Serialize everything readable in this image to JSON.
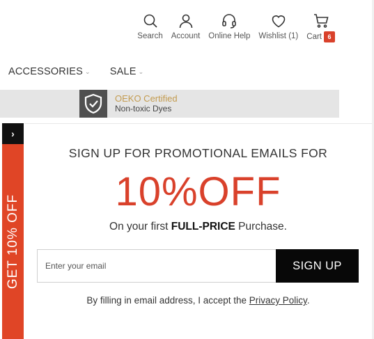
{
  "nav": {
    "search": "Search",
    "account": "Account",
    "help": "Online Help",
    "wishlist": "Wishlist (1)",
    "cart": "Cart",
    "cart_count": "6"
  },
  "categories": [
    {
      "label": "ACCESSORIES",
      "caret": "⌄"
    },
    {
      "label": "SALE",
      "caret": "⌄"
    }
  ],
  "banner": {
    "title": "OEKO Certified",
    "subtitle": "Non-toxic Dyes",
    "icon": "shield-check-icon"
  },
  "side_tab": {
    "arrow": "›",
    "label": "GET 10% OFF"
  },
  "popup": {
    "title": "SIGN UP FOR PROMOTIONAL EMAILS FOR",
    "headline": "10%OFF",
    "sub_prefix": "On your first ",
    "sub_bold": "FULL-PRICE",
    "sub_suffix": " Purchase.",
    "email_placeholder": "Enter your email",
    "email_value": "",
    "signup_label": "SIGN UP",
    "legal_prefix": "By filling in email address, I accept the ",
    "legal_link": "Privacy Policy",
    "legal_suffix": "."
  },
  "colors": {
    "accent": "#d9412b",
    "button": "#080808",
    "oeko_gold": "#c39b4f"
  }
}
